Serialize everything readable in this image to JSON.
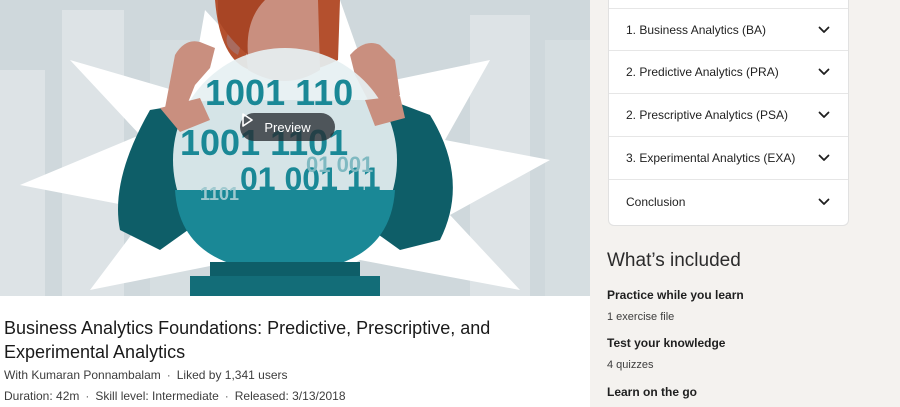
{
  "hero": {
    "preview_label": "Preview",
    "binary_lines": [
      "1001 110",
      "1001 1101",
      "01 001 11",
      "01 001",
      "1101"
    ]
  },
  "course": {
    "title": "Business Analytics Foundations: Predictive, Prescriptive, and Experimental Analytics",
    "author": "With Kumaran Ponnambalam",
    "likes": "Liked by 1,341 users",
    "duration": "Duration: 42m",
    "skill": "Skill level: Intermediate",
    "released": "Released: 3/13/2018"
  },
  "toc": {
    "items": [
      {
        "label": "1. Business Analytics (BA)"
      },
      {
        "label": "2. Predictive Analytics (PRA)"
      },
      {
        "label": "2. Prescriptive Analytics (PSA)"
      },
      {
        "label": "3. Experimental Analytics (EXA)"
      },
      {
        "label": "Conclusion"
      }
    ]
  },
  "included": {
    "title": "What’s included",
    "items": [
      {
        "heading": "Practice while you learn",
        "detail": "1 exercise file"
      },
      {
        "heading": "Test your knowledge",
        "detail": "4 quizzes"
      },
      {
        "heading": "Learn on the go",
        "detail": ""
      }
    ]
  },
  "colors": {
    "teal_dark": "#0e5e68",
    "teal_mid": "#1a8896",
    "sky": "#c9d3d8",
    "hair": "#b4502e",
    "skin": "#c98f7f"
  }
}
